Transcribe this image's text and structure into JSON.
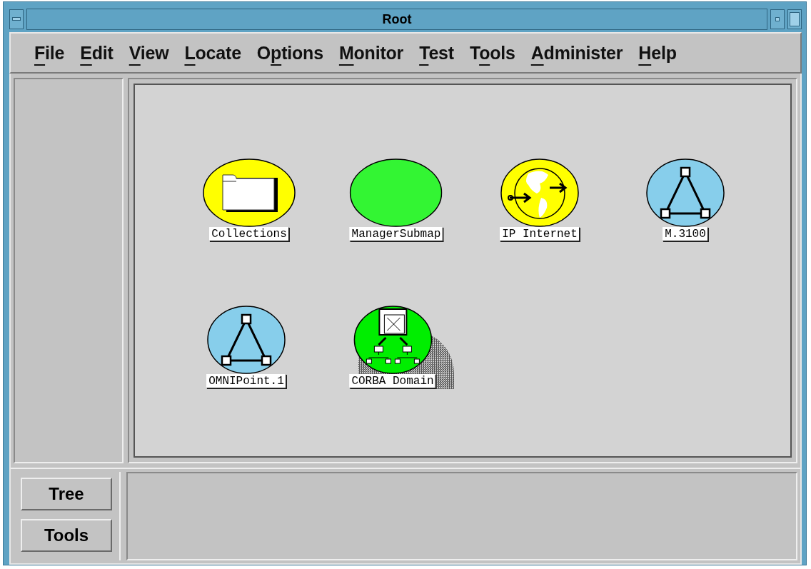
{
  "window": {
    "title": "Root"
  },
  "menu": [
    {
      "mnemonic": "F",
      "after": "ile"
    },
    {
      "mnemonic": "E",
      "after": "dit"
    },
    {
      "mnemonic": "V",
      "after": "iew"
    },
    {
      "mnemonic": "L",
      "after": "ocate"
    },
    {
      "before": "O",
      "mnemonic": "p",
      "after": "tions"
    },
    {
      "mnemonic": "M",
      "after": "onitor"
    },
    {
      "mnemonic": "T",
      "after": "est"
    },
    {
      "before": "T",
      "mnemonic": "o",
      "after": "ols"
    },
    {
      "mnemonic": "A",
      "after": "dminister"
    },
    {
      "mnemonic": "H",
      "after": "elp"
    }
  ],
  "map": {
    "nodes": [
      {
        "label": "Collections",
        "kind": "folder",
        "color": "#ffff00",
        "shadow": false
      },
      {
        "label": "ManagerSubmap",
        "kind": "plain",
        "color": "#33f533",
        "shadow": false
      },
      {
        "label": "IP Internet",
        "kind": "globe",
        "color": "#ffff00",
        "shadow": false
      },
      {
        "label": "M.3100",
        "kind": "triangle",
        "color": "#87ceeb",
        "shadow": false
      },
      {
        "label": "OMNIPoint.1",
        "kind": "triangle",
        "color": "#87ceeb",
        "shadow": false
      },
      {
        "label": "CORBA Domain",
        "kind": "network",
        "color": "#00ee00",
        "shadow": true
      }
    ]
  },
  "buttons": [
    {
      "label": "Tree"
    },
    {
      "label": "Tools"
    }
  ]
}
